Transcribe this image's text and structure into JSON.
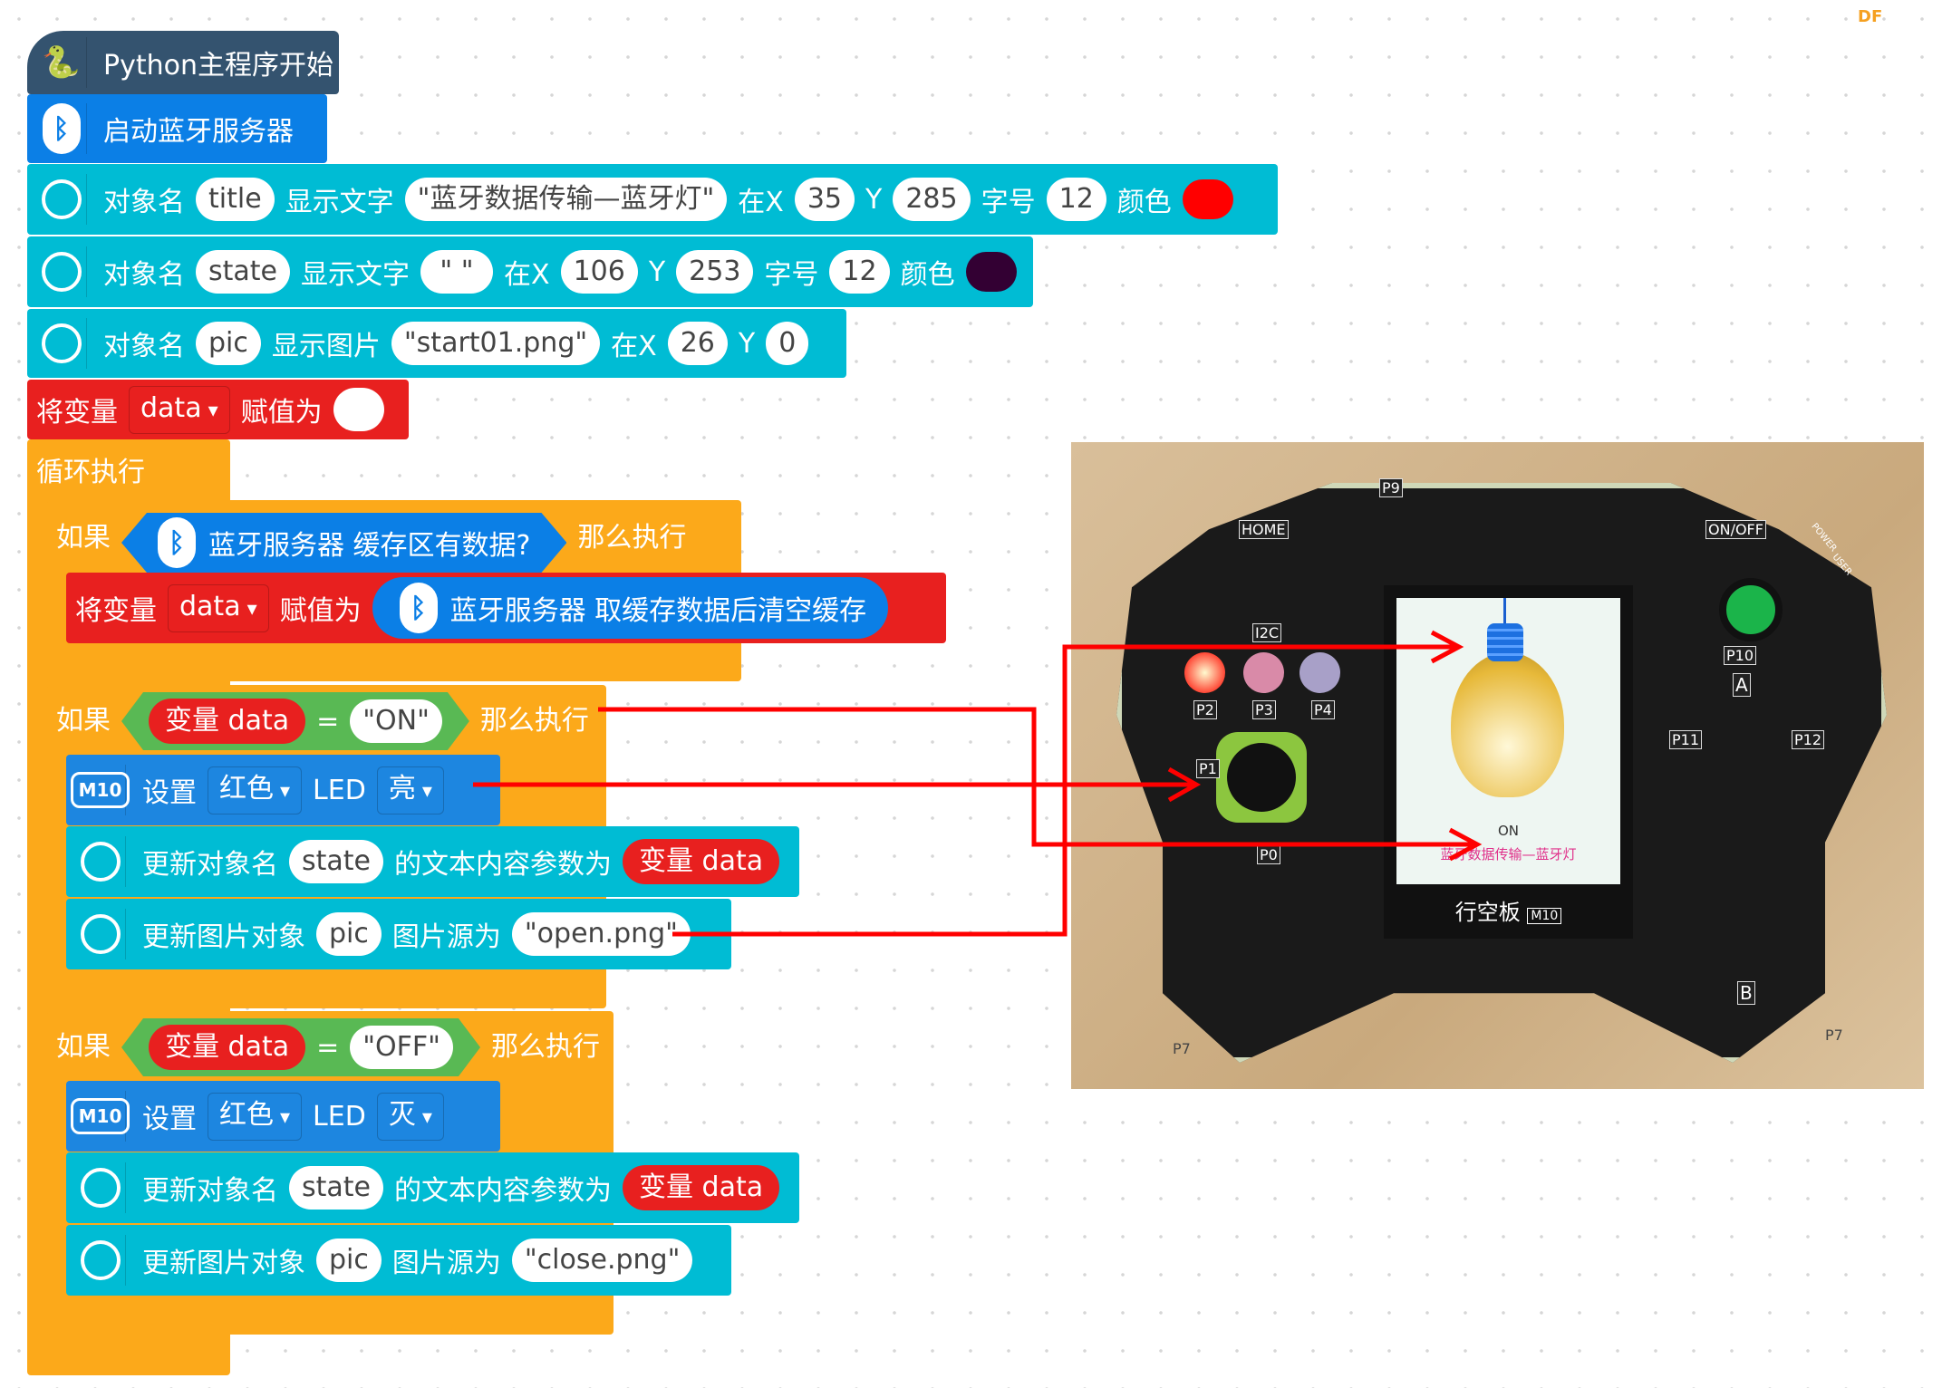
{
  "watermark": "DF",
  "colors": {
    "python": "#34536f",
    "bluetooth": "#0b7fe6",
    "display": "#00bcd4",
    "variable": "#e8201f",
    "control": "#fca91a",
    "logic": "#59b954",
    "arrow": "#ff0000"
  },
  "blocks": {
    "main": "Python主程序开始",
    "bt_start": "启动蓝牙服务器",
    "rows": [
      {
        "obj_label": "对象名",
        "obj": "title",
        "action": "显示文字",
        "value": "\"蓝牙数据传输—蓝牙灯\"",
        "x_label": "在X",
        "x": "35",
        "y_label": "Y",
        "y": "285",
        "size_label": "字号",
        "size": "12",
        "color_label": "颜色",
        "color": "#ff0000"
      },
      {
        "obj_label": "对象名",
        "obj": "state",
        "action": "显示文字",
        "value": "\" \"",
        "x_label": "在X",
        "x": "106",
        "y_label": "Y",
        "y": "253",
        "size_label": "字号",
        "size": "12",
        "color_label": "颜色",
        "color": "#330033"
      },
      {
        "obj_label": "对象名",
        "obj": "pic",
        "action": "显示图片",
        "value": "\"start01.png\"",
        "x_label": "在X",
        "x": "26",
        "y_label": "Y",
        "y": "0"
      }
    ],
    "set_var": {
      "label": "将变量",
      "var": "data",
      "assign": "赋值为",
      "value": ""
    },
    "loop": "循环执行",
    "if1": {
      "if": "如果",
      "cond": "蓝牙服务器 缓存区有数据?",
      "then": "那么执行"
    },
    "set_data": {
      "label": "将变量",
      "var": "data",
      "assign": "赋值为",
      "value": "蓝牙服务器 取缓存数据后清空缓存"
    },
    "if2": {
      "if": "如果",
      "var": "变量 data",
      "op": "=",
      "value": "\"ON\"",
      "then": "那么执行",
      "led": {
        "set": "设置",
        "color": "红色",
        "led": "LED",
        "state": "亮"
      },
      "update_text": {
        "label": "更新对象名",
        "obj": "state",
        "mid": "的文本内容参数为",
        "value": "变量 data"
      },
      "update_pic": {
        "label": "更新图片对象",
        "obj": "pic",
        "mid": "图片源为",
        "value": "\"open.png\""
      }
    },
    "if3": {
      "if": "如果",
      "var": "变量 data",
      "op": "=",
      "value": "\"OFF\"",
      "then": "那么执行",
      "led": {
        "set": "设置",
        "color": "红色",
        "led": "LED",
        "state": "灭"
      },
      "update_text": {
        "label": "更新对象名",
        "obj": "state",
        "mid": "的文本内容参数为",
        "value": "变量 data"
      },
      "update_pic": {
        "label": "更新图片对象",
        "obj": "pic",
        "mid": "图片源为",
        "value": "\"close.png\""
      }
    },
    "m10_icon": "M10"
  },
  "photo": {
    "screen_state": "ON",
    "screen_title": "蓝牙数据传输—蓝牙灯",
    "brand": "行空板",
    "brand_badge": "M10",
    "labels": {
      "home": "HOME",
      "onoff": "ON/OFF",
      "p9": "P9",
      "i2c": "I2C",
      "p2": "P2",
      "p3": "P3",
      "p4": "P4",
      "p10": "P10",
      "a": "A",
      "b": "B",
      "p11": "P11",
      "p12": "P12",
      "p1": "P1",
      "p0": "P0",
      "p7": "P7",
      "power": "POWER",
      "user": "USER"
    }
  }
}
